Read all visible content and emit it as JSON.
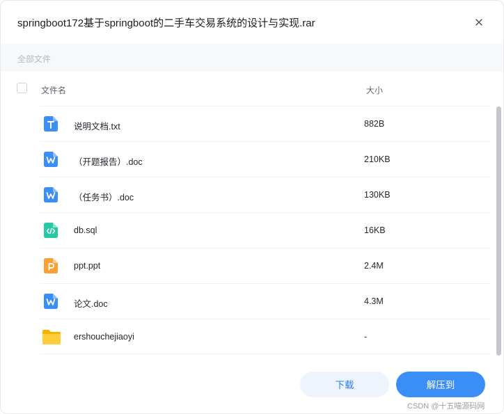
{
  "dialog": {
    "title": "springboot172基于springboot的二手车交易系统的设计与实现.rar",
    "close_icon": "close-icon"
  },
  "breadcrumb": {
    "label": "全部文件"
  },
  "table": {
    "header_name": "文件名",
    "header_size": "大小"
  },
  "files": [
    {
      "name": "说明文档.txt",
      "size": "882B",
      "icon": "txt-file-icon",
      "color": "#3b8ef6"
    },
    {
      "name": "（开题报告）.doc",
      "size": "210KB",
      "icon": "word-file-icon",
      "color": "#3b8ef6"
    },
    {
      "name": "（任务书）.doc",
      "size": "130KB",
      "icon": "word-file-icon",
      "color": "#3b8ef6"
    },
    {
      "name": "db.sql",
      "size": "16KB",
      "icon": "code-file-icon",
      "color": "#26c9a3"
    },
    {
      "name": "ppt.ppt",
      "size": "2.4M",
      "icon": "ppt-file-icon",
      "color": "#f7a035"
    },
    {
      "name": "论文.doc",
      "size": "4.3M",
      "icon": "word-file-icon",
      "color": "#3b8ef6"
    },
    {
      "name": "ershouchejiaoyi",
      "size": "-",
      "icon": "folder-icon",
      "color": "#ffc935"
    }
  ],
  "buttons": {
    "download": "下载",
    "extract": "解压到"
  },
  "watermark": "CSDN @十五喵源码网"
}
